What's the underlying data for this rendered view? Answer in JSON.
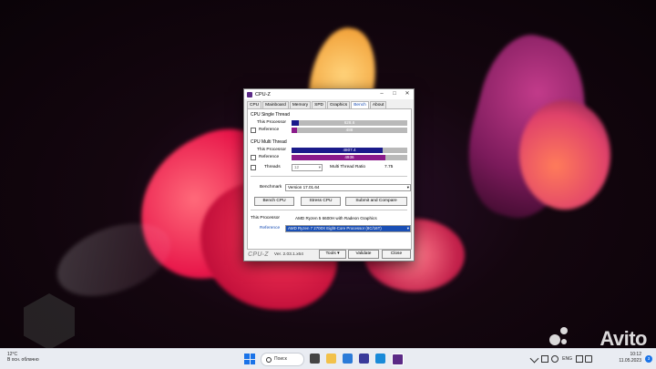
{
  "window": {
    "title": "CPU-Z",
    "tabs": [
      "CPU",
      "Mainboard",
      "Memory",
      "SPD",
      "Graphics",
      "Bench",
      "About"
    ],
    "active_tab": "Bench",
    "single_thread": {
      "section": "CPU Single Thread",
      "this_label": "This Processor",
      "this_value": "628.6",
      "this_fraction": 0.06,
      "ref_label": "Reference",
      "ref_value": "488",
      "ref_fraction": 0.05
    },
    "multi_thread": {
      "section": "CPU Multi Thread",
      "this_label": "This Processor",
      "this_value": "4807.4",
      "this_fraction": 0.79,
      "ref_label": "Reference",
      "ref_value": "4936",
      "ref_fraction": 0.81,
      "threads_label": "Threads",
      "threads_value": "12",
      "ratio_label": "Multi Thread Ratio",
      "ratio_value": "7.75"
    },
    "benchmark_label": "Benchmark",
    "benchmark_version": "Version 17.01.64",
    "buttons": {
      "bench_cpu": "Bench CPU",
      "stress_cpu": "Stress CPU",
      "submit_compare": "Submit and Compare"
    },
    "this_processor_label": "This Processor",
    "this_processor_name": "AMD Ryzen 5 6600H with Radeon Graphics",
    "reference_label": "Reference",
    "reference_name": "AMD Ryzen 7 2700X Eight-Core Processor (8C/16T)",
    "logo": "CPU-Z",
    "version": "Ver. 2.03.1.x64",
    "tools": "Tools",
    "validate": "Validate",
    "close": "Close"
  },
  "taskbar": {
    "weather_temp": "12°C",
    "weather_desc": "В осн. облачно",
    "search": "Поиск",
    "lang": "ENG",
    "time": "10:12",
    "date": "11.05.2023",
    "notifications": "3"
  },
  "watermark": "Avito",
  "colors": {
    "this_bar": "#1a1a8a",
    "ref_bar": "#8a1a8a",
    "accent": "#1a4fb5"
  }
}
